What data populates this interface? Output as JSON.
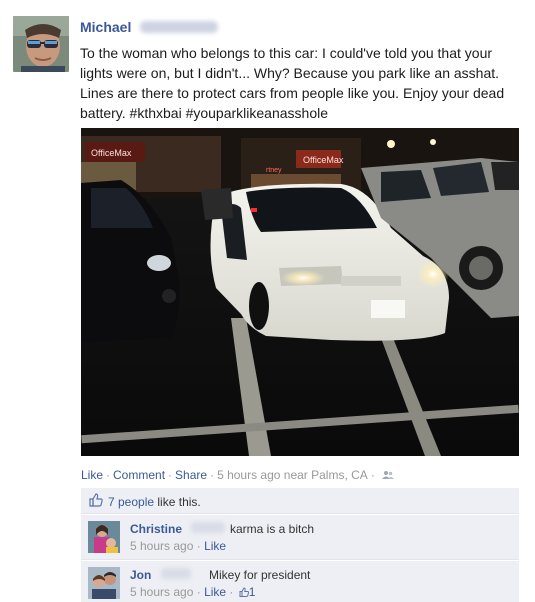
{
  "post": {
    "author": "Michael",
    "text": "To the woman who belongs to this car: I could've told you that your lights were on, but I didn't... Why? Because you park like an asshat. Lines are there to protect cars from people like you. Enjoy your dead battery. #kthxbai #youparklikeanasshole",
    "photo_sign_1": "OfficeMax",
    "photo_sign_2": "OfficeMax",
    "photo_sign_3": "rtney"
  },
  "actions": {
    "like": "Like",
    "comment": "Comment",
    "share": "Share",
    "sep": "·",
    "time_location": "5 hours ago near Palms, CA",
    "audience_icon": "friends-icon"
  },
  "likes": {
    "count_label": "7 people",
    "suffix": "like this."
  },
  "comments": [
    {
      "author": "Christine",
      "text": "karma is a bitch",
      "time": "5 hours ago",
      "like_label": "Like"
    },
    {
      "author": "Jon",
      "text": "Mikey for president",
      "time": "5 hours ago",
      "like_label": "Like",
      "like_count": "1"
    }
  ],
  "colors": {
    "link": "#3b5998",
    "feedback_bg": "#edeff4",
    "meta": "#999999"
  }
}
